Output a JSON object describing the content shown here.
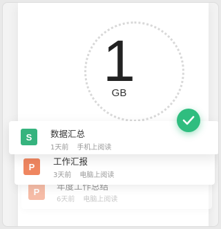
{
  "storage": {
    "value": "1",
    "unit": "GB"
  },
  "files": [
    {
      "title": "数据汇总",
      "time": "1天前",
      "source": "手机上阅读",
      "icon": "spreadsheet-icon",
      "icon_letter": "S",
      "icon_color": "#36b37e"
    },
    {
      "title": "工作汇报",
      "time": "3天前",
      "source": "电脑上阅读",
      "icon": "presentation-icon",
      "icon_letter": "P",
      "icon_color": "#ef8660"
    },
    {
      "title": "年度工作总结",
      "time": "6天前",
      "source": "电脑上阅读",
      "icon": "presentation-icon",
      "icon_letter": "P",
      "icon_color": "#ef8660"
    }
  ],
  "status": {
    "icon": "checkmark-icon",
    "color": "#2fbd7f"
  }
}
